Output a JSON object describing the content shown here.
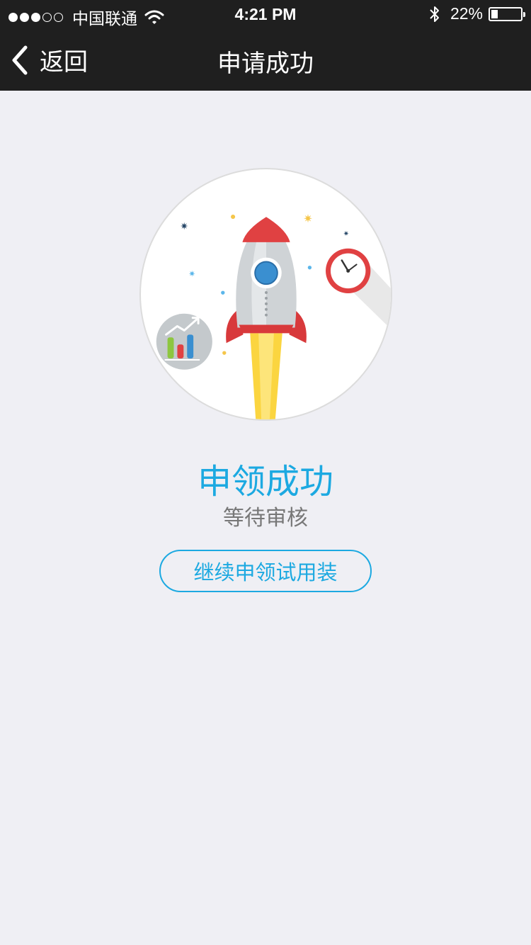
{
  "status_bar": {
    "carrier": "中国联通",
    "time": "4:21 PM",
    "battery_percent": "22%",
    "battery_level": 0.22,
    "signal_bars": 3,
    "signal_total": 5
  },
  "nav": {
    "back_label": "返回",
    "title": "申请成功"
  },
  "result": {
    "headline": "申领成功",
    "subline": "等待审核",
    "continue_button": "继续申领试用装"
  },
  "colors": {
    "accent": "#1ca9e1",
    "nav_background": "#1f1f1f",
    "page_background": "#efeff4"
  }
}
